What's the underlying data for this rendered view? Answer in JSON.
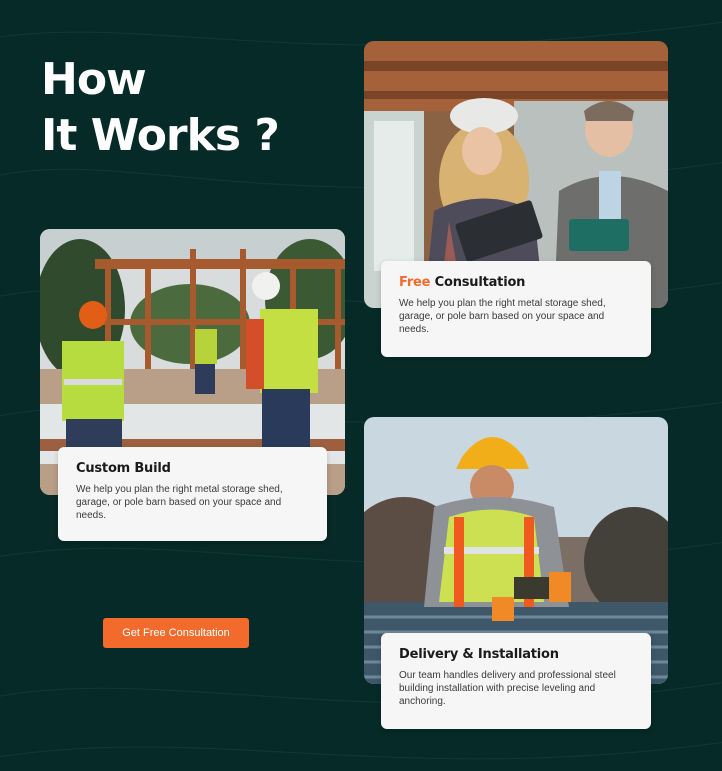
{
  "section": {
    "heading_line1": "How",
    "heading_line2": "It Works ?"
  },
  "cards": {
    "consultation": {
      "title_accent": "Free",
      "title_rest": " Consultation",
      "description": "We help you plan the right metal storage shed, garage, or pole barn based on your space and needs."
    },
    "custom_build": {
      "title": "Custom Build",
      "description": "We help you plan the right metal storage shed, garage, or pole barn based on your space and needs."
    },
    "delivery": {
      "title": "Delivery & Installation",
      "description": "Our team handles delivery and professional steel building installation with precise leveling and anchoring."
    }
  },
  "cta": {
    "label": "Get Free Consultation"
  },
  "colors": {
    "background": "#062a27",
    "accent": "#f26b2d",
    "card": "#f6f6f6"
  },
  "images": {
    "consultation_photo": "photo of woman in hard hat with clipboard and man with tablet",
    "custom_build_photo": "photo of workers in safety vests at timber frame construction site",
    "delivery_photo": "photo of worker in hard hat using drill on metal roof"
  }
}
